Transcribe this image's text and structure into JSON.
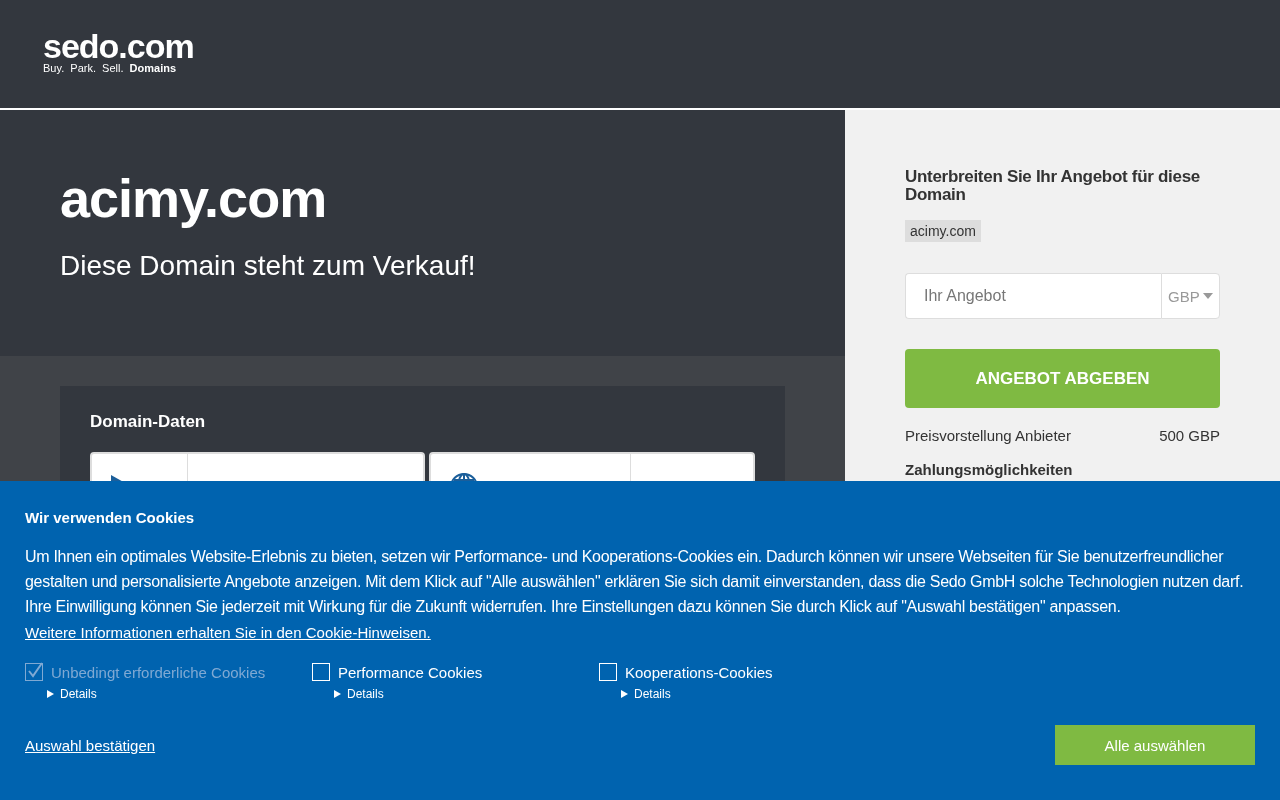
{
  "header": {
    "logo": {
      "name": "sedo.com",
      "tagline": "Buy.  Park.  Sell.  **Domains**"
    }
  },
  "hero": {
    "domain": "acimy.com",
    "subtitle": "Diese Domain steht zum Verkauf!"
  },
  "domain_data": {
    "title": "Domain-Daten",
    "cards": [
      {
        "kind": "play"
      },
      {
        "kind": "globe"
      }
    ]
  },
  "offer": {
    "title": "Unterbreiten Sie Ihr Angebot für diese Domain",
    "domain_tag": "acimy.com",
    "amount_field": {
      "placeholder": "Ihr Angebot"
    },
    "currency": "GBP",
    "submit": "ANGEBOT ABGEBEN",
    "price_label": "Preisvorstellung Anbieter",
    "price_value": "500 GBP",
    "payment_heading": "Zahlungsmöglichkeiten"
  },
  "cookie_banner": {
    "title": "Wir verwenden Cookies",
    "text": "Um Ihnen ein optimales Website-Erlebnis zu bieten, setzen wir Performance- und Kooperations-Cookies ein. Dadurch können wir unsere Webseiten für Sie benutzerfreundlicher gestalten und personalisierte Angebote anzeigen. Mit dem Klick auf \"Alle auswählen\" erklären Sie sich damit einverstanden, dass die Sedo GmbH solche Technologien nutzen darf. Ihre Einwilligung können Sie jederzeit mit Wirkung für die Zukunft widerrufen. Ihre Einstellungen dazu können Sie durch Klick auf \"Auswahl bestätigen\" anpassen.",
    "link": "Weitere Informationen erhalten Sie in den Cookie-Hinweisen.",
    "options": [
      {
        "label": "Unbedingt erforderliche Cookies",
        "checked": true,
        "disabled": true,
        "details": "Details"
      },
      {
        "label": "Performance Cookies",
        "checked": false,
        "disabled": false,
        "details": "Details"
      },
      {
        "label": "Kooperations-Cookies",
        "checked": false,
        "disabled": false,
        "details": "Details"
      }
    ],
    "confirm": "Auswahl bestätigen",
    "accept_all": "Alle auswählen"
  }
}
